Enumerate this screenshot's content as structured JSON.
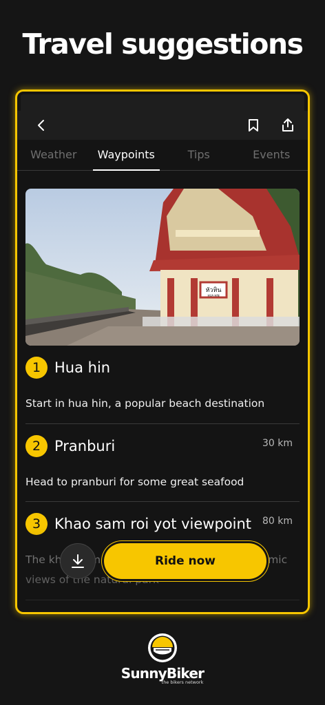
{
  "headline": "Travel suggestions",
  "topbar": {
    "back_icon": "chevron-left-icon",
    "bookmark_icon": "bookmark-icon",
    "share_icon": "share-icon"
  },
  "tabs": [
    {
      "label": "Weather",
      "active": false
    },
    {
      "label": "Waypoints",
      "active": true
    },
    {
      "label": "Tips",
      "active": false
    },
    {
      "label": "Events",
      "active": false
    }
  ],
  "photo": {
    "sign_thai": "หัวหิน",
    "sign_latin": "HUA HIN"
  },
  "waypoints": [
    {
      "number": "1",
      "title": "Hua hin",
      "distance": "",
      "description": "Start in hua hin, a popular beach destination"
    },
    {
      "number": "2",
      "title": "Pranburi",
      "distance": "30 km",
      "description": "Head to pranburi for some great seafood"
    },
    {
      "number": "3",
      "title": "Khao sam roi yot viewpoint",
      "distance": "80 km",
      "description": "The khao sam roi yot viewpoint offers panoramic views of the natural park"
    }
  ],
  "actions": {
    "ride_label": "Ride now",
    "download_icon": "download-icon"
  },
  "brand": {
    "name": "SunnyBiker",
    "tagline": "the bikers network"
  },
  "colors": {
    "accent": "#f7c600",
    "background": "#151515"
  }
}
